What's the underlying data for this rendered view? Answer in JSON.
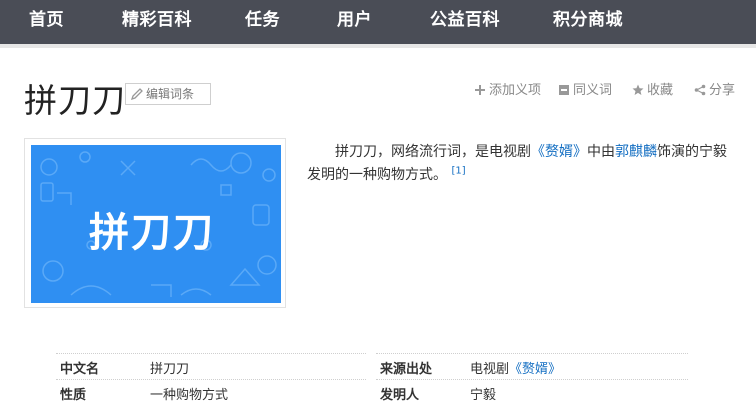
{
  "nav": {
    "items": [
      {
        "label": "首页"
      },
      {
        "label": "精彩百科"
      },
      {
        "label": "任务"
      },
      {
        "label": "用户"
      },
      {
        "label": "公益百科"
      },
      {
        "label": "积分商城"
      }
    ]
  },
  "lemma": {
    "title": "拼刀刀",
    "edit_label": "编辑词条"
  },
  "tools": {
    "add_meaning": "添加义项",
    "synonym": "同义词",
    "collect": "收藏",
    "share": "分享"
  },
  "image": {
    "text": "拼刀刀"
  },
  "summary": {
    "prefix": "拼刀刀，网络流行词，是电视剧",
    "drama_link": "《赘婿》",
    "mid": "中由",
    "actor_link": "郭麒麟",
    "suffix": "饰演的宁毅发明的一种购物方式。",
    "ref": "[1]"
  },
  "basic_info": {
    "left": [
      {
        "key": "中文名",
        "value": "拼刀刀"
      },
      {
        "key": "性质",
        "value": "一种购物方式"
      }
    ],
    "right": [
      {
        "key": "来源出处",
        "value_prefix": "电视剧",
        "value_link": "《赘婿》"
      },
      {
        "key": "发明人",
        "value": "宁毅"
      }
    ]
  },
  "colors": {
    "nav_bg": "#4a4d56",
    "link": "#136ec2",
    "image_bg": "#2f8ff2"
  }
}
